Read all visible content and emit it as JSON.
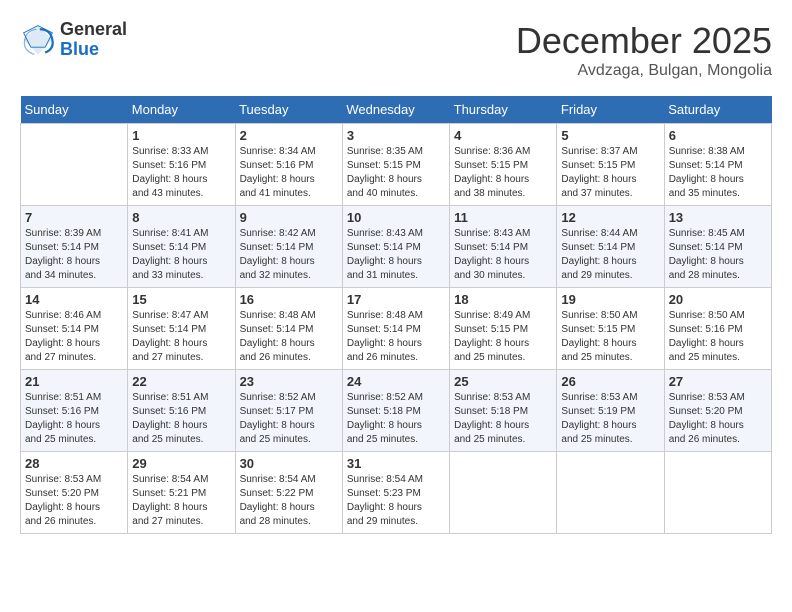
{
  "header": {
    "logo_line1": "General",
    "logo_line2": "Blue",
    "month": "December 2025",
    "location": "Avdzaga, Bulgan, Mongolia"
  },
  "weekdays": [
    "Sunday",
    "Monday",
    "Tuesday",
    "Wednesday",
    "Thursday",
    "Friday",
    "Saturday"
  ],
  "weeks": [
    [
      {
        "day": "",
        "info": ""
      },
      {
        "day": "1",
        "info": "Sunrise: 8:33 AM\nSunset: 5:16 PM\nDaylight: 8 hours\nand 43 minutes."
      },
      {
        "day": "2",
        "info": "Sunrise: 8:34 AM\nSunset: 5:16 PM\nDaylight: 8 hours\nand 41 minutes."
      },
      {
        "day": "3",
        "info": "Sunrise: 8:35 AM\nSunset: 5:15 PM\nDaylight: 8 hours\nand 40 minutes."
      },
      {
        "day": "4",
        "info": "Sunrise: 8:36 AM\nSunset: 5:15 PM\nDaylight: 8 hours\nand 38 minutes."
      },
      {
        "day": "5",
        "info": "Sunrise: 8:37 AM\nSunset: 5:15 PM\nDaylight: 8 hours\nand 37 minutes."
      },
      {
        "day": "6",
        "info": "Sunrise: 8:38 AM\nSunset: 5:14 PM\nDaylight: 8 hours\nand 35 minutes."
      }
    ],
    [
      {
        "day": "7",
        "info": "Sunrise: 8:39 AM\nSunset: 5:14 PM\nDaylight: 8 hours\nand 34 minutes."
      },
      {
        "day": "8",
        "info": "Sunrise: 8:41 AM\nSunset: 5:14 PM\nDaylight: 8 hours\nand 33 minutes."
      },
      {
        "day": "9",
        "info": "Sunrise: 8:42 AM\nSunset: 5:14 PM\nDaylight: 8 hours\nand 32 minutes."
      },
      {
        "day": "10",
        "info": "Sunrise: 8:43 AM\nSunset: 5:14 PM\nDaylight: 8 hours\nand 31 minutes."
      },
      {
        "day": "11",
        "info": "Sunrise: 8:43 AM\nSunset: 5:14 PM\nDaylight: 8 hours\nand 30 minutes."
      },
      {
        "day": "12",
        "info": "Sunrise: 8:44 AM\nSunset: 5:14 PM\nDaylight: 8 hours\nand 29 minutes."
      },
      {
        "day": "13",
        "info": "Sunrise: 8:45 AM\nSunset: 5:14 PM\nDaylight: 8 hours\nand 28 minutes."
      }
    ],
    [
      {
        "day": "14",
        "info": "Sunrise: 8:46 AM\nSunset: 5:14 PM\nDaylight: 8 hours\nand 27 minutes."
      },
      {
        "day": "15",
        "info": "Sunrise: 8:47 AM\nSunset: 5:14 PM\nDaylight: 8 hours\nand 27 minutes."
      },
      {
        "day": "16",
        "info": "Sunrise: 8:48 AM\nSunset: 5:14 PM\nDaylight: 8 hours\nand 26 minutes."
      },
      {
        "day": "17",
        "info": "Sunrise: 8:48 AM\nSunset: 5:14 PM\nDaylight: 8 hours\nand 26 minutes."
      },
      {
        "day": "18",
        "info": "Sunrise: 8:49 AM\nSunset: 5:15 PM\nDaylight: 8 hours\nand 25 minutes."
      },
      {
        "day": "19",
        "info": "Sunrise: 8:50 AM\nSunset: 5:15 PM\nDaylight: 8 hours\nand 25 minutes."
      },
      {
        "day": "20",
        "info": "Sunrise: 8:50 AM\nSunset: 5:16 PM\nDaylight: 8 hours\nand 25 minutes."
      }
    ],
    [
      {
        "day": "21",
        "info": "Sunrise: 8:51 AM\nSunset: 5:16 PM\nDaylight: 8 hours\nand 25 minutes."
      },
      {
        "day": "22",
        "info": "Sunrise: 8:51 AM\nSunset: 5:16 PM\nDaylight: 8 hours\nand 25 minutes."
      },
      {
        "day": "23",
        "info": "Sunrise: 8:52 AM\nSunset: 5:17 PM\nDaylight: 8 hours\nand 25 minutes."
      },
      {
        "day": "24",
        "info": "Sunrise: 8:52 AM\nSunset: 5:18 PM\nDaylight: 8 hours\nand 25 minutes."
      },
      {
        "day": "25",
        "info": "Sunrise: 8:53 AM\nSunset: 5:18 PM\nDaylight: 8 hours\nand 25 minutes."
      },
      {
        "day": "26",
        "info": "Sunrise: 8:53 AM\nSunset: 5:19 PM\nDaylight: 8 hours\nand 25 minutes."
      },
      {
        "day": "27",
        "info": "Sunrise: 8:53 AM\nSunset: 5:20 PM\nDaylight: 8 hours\nand 26 minutes."
      }
    ],
    [
      {
        "day": "28",
        "info": "Sunrise: 8:53 AM\nSunset: 5:20 PM\nDaylight: 8 hours\nand 26 minutes."
      },
      {
        "day": "29",
        "info": "Sunrise: 8:54 AM\nSunset: 5:21 PM\nDaylight: 8 hours\nand 27 minutes."
      },
      {
        "day": "30",
        "info": "Sunrise: 8:54 AM\nSunset: 5:22 PM\nDaylight: 8 hours\nand 28 minutes."
      },
      {
        "day": "31",
        "info": "Sunrise: 8:54 AM\nSunset: 5:23 PM\nDaylight: 8 hours\nand 29 minutes."
      },
      {
        "day": "",
        "info": ""
      },
      {
        "day": "",
        "info": ""
      },
      {
        "day": "",
        "info": ""
      }
    ]
  ]
}
